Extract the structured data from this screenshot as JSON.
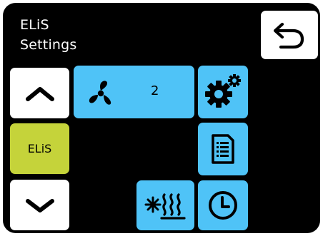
{
  "header": {
    "line1": "ELiS",
    "line2": "Settings"
  },
  "buttons": {
    "back_icon": "back-arrow-icon",
    "up_icon": "chevron-up-icon",
    "down_icon": "chevron-down-icon",
    "mode_label": "ELiS",
    "fan_icon": "fan-icon",
    "fan_level": "2",
    "settings_icon": "gears-icon",
    "document_icon": "document-list-icon",
    "heating_icon": "heat-exchanger-icon",
    "timer_icon": "clock-icon"
  },
  "colors": {
    "background": "#000000",
    "accent_blue": "#4fc3f7",
    "accent_lime": "#c5d33a",
    "button_white": "#ffffff"
  }
}
